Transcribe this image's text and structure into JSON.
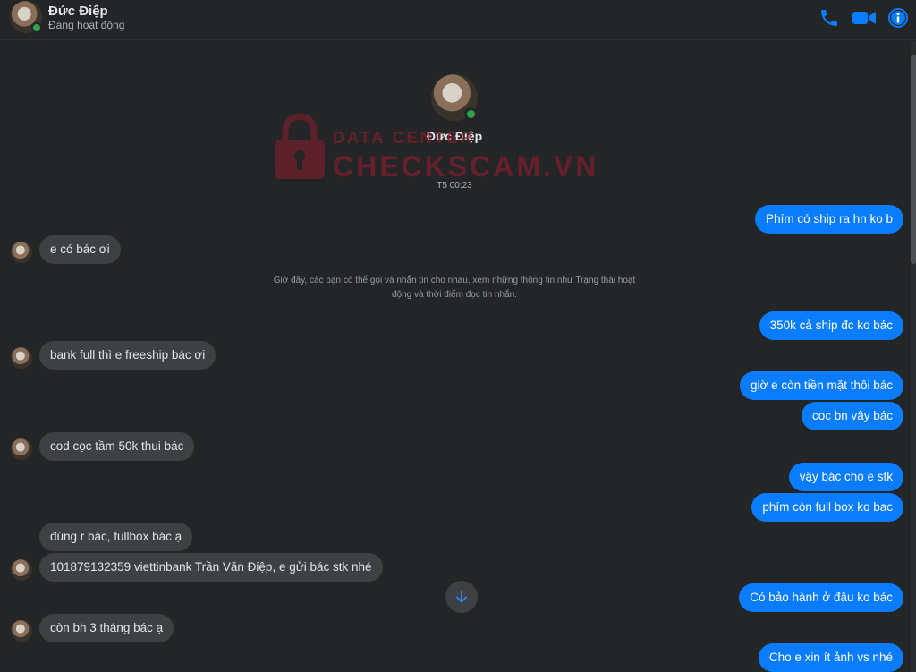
{
  "header": {
    "name": "Đức Điệp",
    "status": "Đang hoạt động",
    "call_icon": "phone-icon",
    "video_icon": "video-camera-icon",
    "info_icon": "info-icon",
    "accent": "#0a7cff"
  },
  "intro": {
    "name": "Đức Điệp",
    "timestamp": "T5 00:23"
  },
  "system_note": "Giờ đây, các bạn có thể gọi và nhắn tin cho nhau, xem những thông tin như Trạng thái hoạt động và thời điểm đọc tin nhắn.",
  "watermark": {
    "line1": "DATA CENTER",
    "line2": "CHECKSCAM.VN",
    "icon": "lock-icon"
  },
  "messages": [
    {
      "side": "out",
      "text": "Phím có ship ra hn ko b"
    },
    {
      "side": "in",
      "text": "e có bác ơi"
    },
    {
      "side": "out",
      "text": "350k cả ship đc ko bác"
    },
    {
      "side": "in",
      "text": "bank full thì e freeship bác ơi"
    },
    {
      "side": "out",
      "text": "giờ e còn tiền mặt thôi bác"
    },
    {
      "side": "out",
      "text": "cọc bn vậy bác"
    },
    {
      "side": "in",
      "text": "cod cọc tầm 50k thui bác"
    },
    {
      "side": "out",
      "text": "vậy bác cho e stk"
    },
    {
      "side": "out",
      "text": "phím còn full box ko bac"
    },
    {
      "side": "in",
      "text": "đúng r bác, fullbox bác ạ"
    },
    {
      "side": "in",
      "text": "101879132359 viettinbank Trần Văn Điệp, e gửi bác stk nhé"
    },
    {
      "side": "out",
      "text": "Có bảo hành ở đâu ko bác"
    },
    {
      "side": "in",
      "text": "còn bh 3 tháng bác ạ"
    },
    {
      "side": "out",
      "text": "Cho e xin ít ảnh vs nhé"
    }
  ],
  "scroll_down_icon": "arrow-down-icon"
}
